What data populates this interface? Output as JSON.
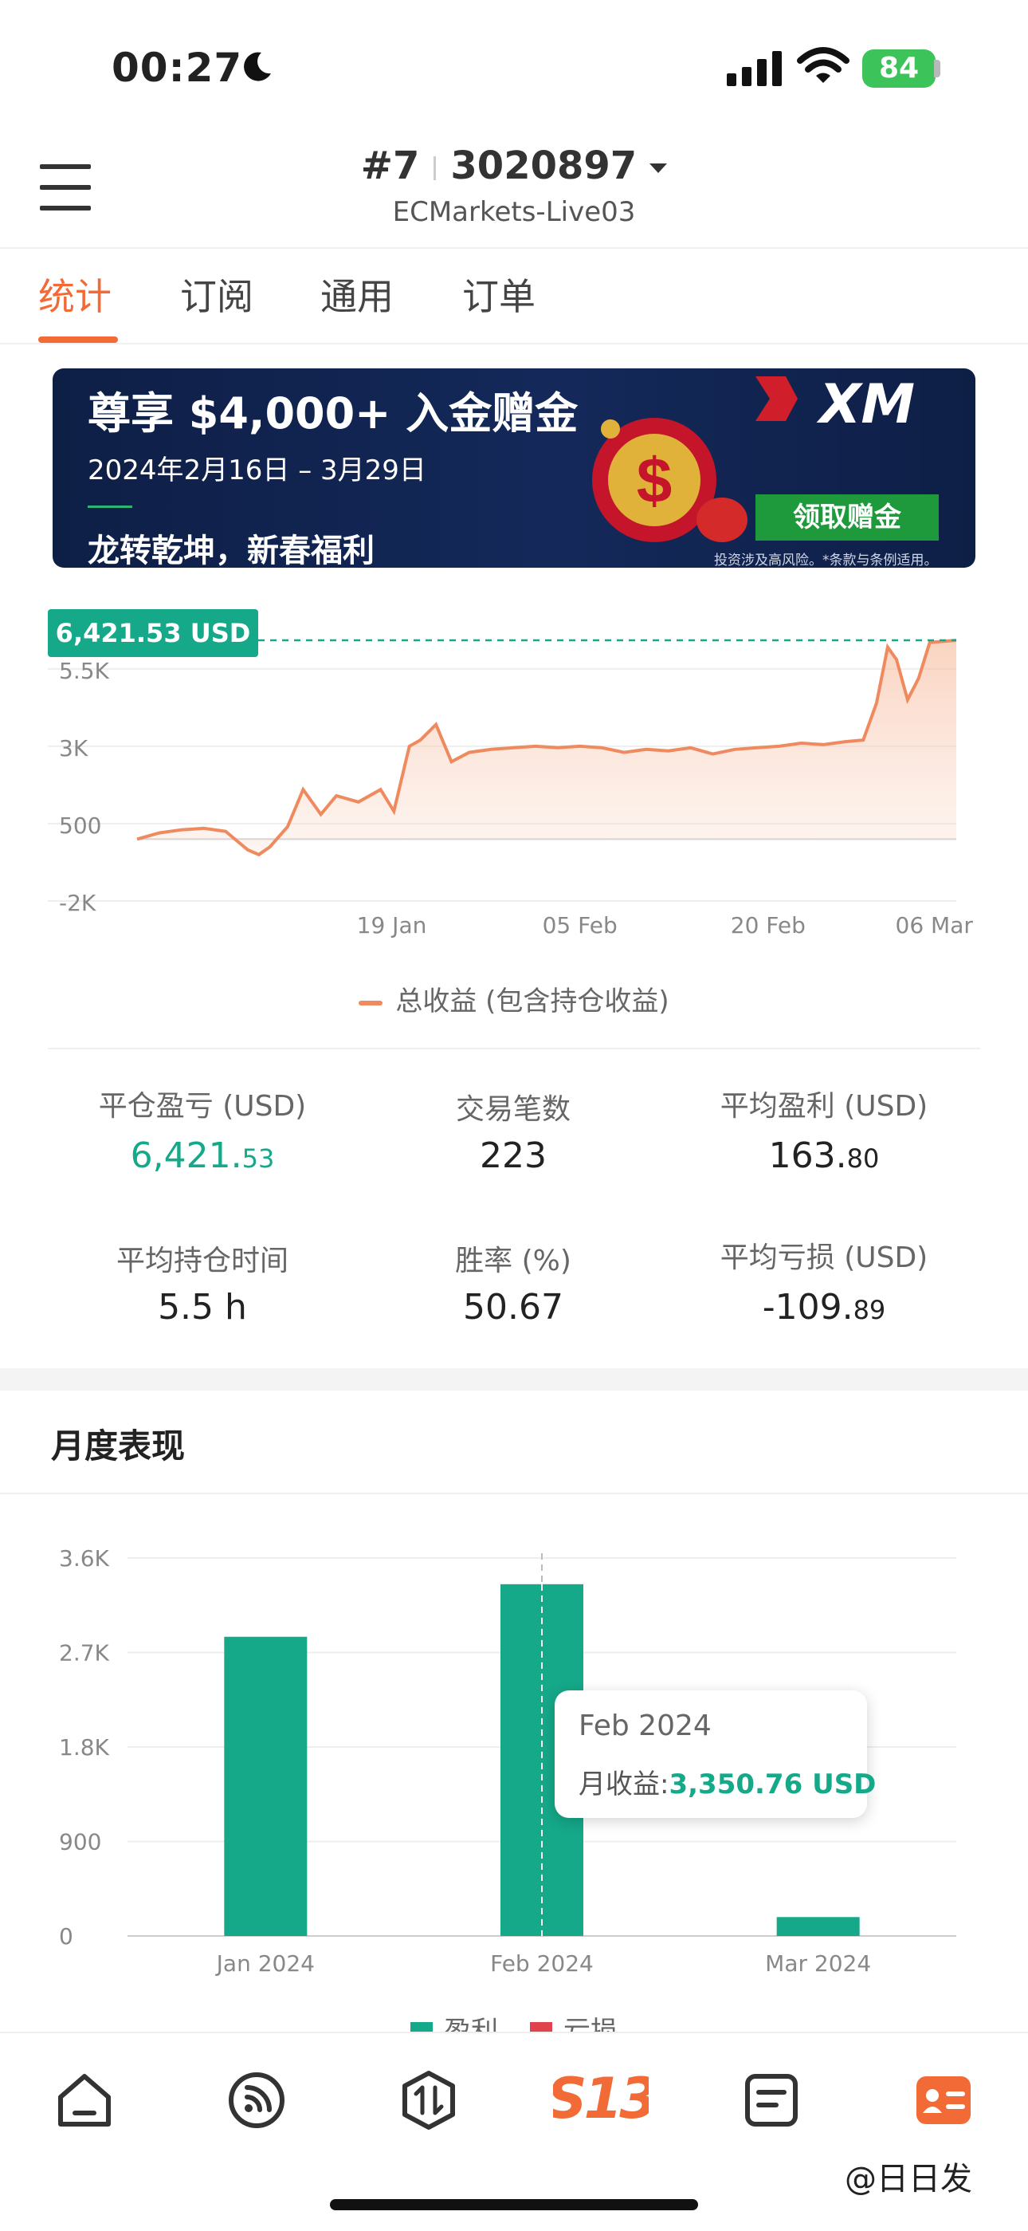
{
  "status_bar": {
    "time": "00:27",
    "battery": "84"
  },
  "header": {
    "account_no": "#7",
    "account_id": "3020897",
    "server": "ECMarkets-Live03"
  },
  "tabs": [
    {
      "label": "统计",
      "active": true
    },
    {
      "label": "订阅",
      "active": false
    },
    {
      "label": "通用",
      "active": false
    },
    {
      "label": "订单",
      "active": false
    }
  ],
  "banner": {
    "title": "尊享 $4,000+ 入金赠金",
    "date": "2024年2月16日 – 3月29日",
    "subtitle": "龙转乾坤，新春福利",
    "brand": "XM",
    "button": "领取赠金",
    "disclaimer": "投资涉及高风险。*条款与条例适用。"
  },
  "pnl_badge": "6,421.53 USD",
  "legend_line": "总收益 (包含持仓收益)",
  "stats": [
    {
      "label": "平仓盈亏 (USD)",
      "int": "6,421.",
      "dec": "53",
      "highlight": true
    },
    {
      "label": "交易笔数",
      "int": "223",
      "dec": ""
    },
    {
      "label": "平均盈利 (USD)",
      "int": "163.",
      "dec": "80"
    },
    {
      "label": "平均持仓时间",
      "int": "5.5 h",
      "dec": ""
    },
    {
      "label": "胜率 (%)",
      "int": "50.67",
      "dec": ""
    },
    {
      "label": "平均亏损 (USD)",
      "int": "-109.",
      "dec": "89"
    }
  ],
  "monthly": {
    "title": "月度表现"
  },
  "tooltip": {
    "date": "Feb 2024",
    "label": "月收益:",
    "value": "3,350.76 USD"
  },
  "legend_bar": {
    "profit": "盈利",
    "loss": "亏损"
  },
  "watermark": "@日日发",
  "colors": {
    "accent": "#f26a35",
    "green": "#15a889",
    "loss": "#e0434b",
    "line": "#ef8a5f"
  },
  "chart_data": [
    {
      "type": "area",
      "ylim": [
        -2000,
        6500
      ],
      "y_ticks": [
        "-2K",
        "500",
        "3K",
        "5.5K"
      ],
      "y_tick_values": [
        -2000,
        500,
        3000,
        5500
      ],
      "x_ticks": [
        "19 Jan",
        "05 Feb",
        "20 Feb",
        "06 Mar"
      ],
      "x_tick_positions": [
        11.5,
        20,
        28.5,
        36
      ],
      "x_range": [
        0,
        37
      ],
      "series": [
        {
          "values": [
            [
              0,
              0
            ],
            [
              1,
              200
            ],
            [
              2,
              300
            ],
            [
              3,
              350
            ],
            [
              4,
              250
            ],
            [
              5,
              -350
            ],
            [
              5.5,
              -500
            ],
            [
              6,
              -250
            ],
            [
              6.8,
              400
            ],
            [
              7.5,
              1600
            ],
            [
              8.3,
              800
            ],
            [
              9,
              1400
            ],
            [
              10,
              1200
            ],
            [
              11,
              1600
            ],
            [
              11.6,
              900
            ],
            [
              12.3,
              3000
            ],
            [
              12.8,
              3200
            ],
            [
              13.5,
              3700
            ],
            [
              14.2,
              2500
            ],
            [
              15,
              2800
            ],
            [
              16,
              2900
            ],
            [
              17,
              2950
            ],
            [
              18,
              3000
            ],
            [
              19,
              2950
            ],
            [
              20,
              3000
            ],
            [
              21,
              2950
            ],
            [
              22,
              2800
            ],
            [
              23,
              2900
            ],
            [
              24,
              2850
            ],
            [
              25,
              2950
            ],
            [
              26,
              2750
            ],
            [
              27,
              2900
            ],
            [
              28,
              2950
            ],
            [
              29,
              3000
            ],
            [
              30,
              3100
            ],
            [
              31,
              3050
            ],
            [
              32,
              3150
            ],
            [
              32.8,
              3200
            ],
            [
              33.4,
              4400
            ],
            [
              33.9,
              6200
            ],
            [
              34.3,
              5800
            ],
            [
              34.8,
              4500
            ],
            [
              35.3,
              5200
            ],
            [
              35.8,
              6350
            ],
            [
              37,
              6421.53
            ]
          ]
        }
      ],
      "reference_value": 6421.53
    },
    {
      "type": "bar",
      "categories": [
        "Jan 2024",
        "Feb 2024",
        "Mar 2024"
      ],
      "values": [
        2850,
        3350.76,
        180
      ],
      "y_ticks": [
        "0",
        "900",
        "1.8K",
        "2.7K",
        "3.6K"
      ],
      "y_tick_values": [
        0,
        900,
        1800,
        2700,
        3600
      ],
      "ylim": [
        0,
        3600
      ],
      "legend": [
        "盈利",
        "亏损"
      ],
      "highlighted_category": "Feb 2024"
    }
  ]
}
